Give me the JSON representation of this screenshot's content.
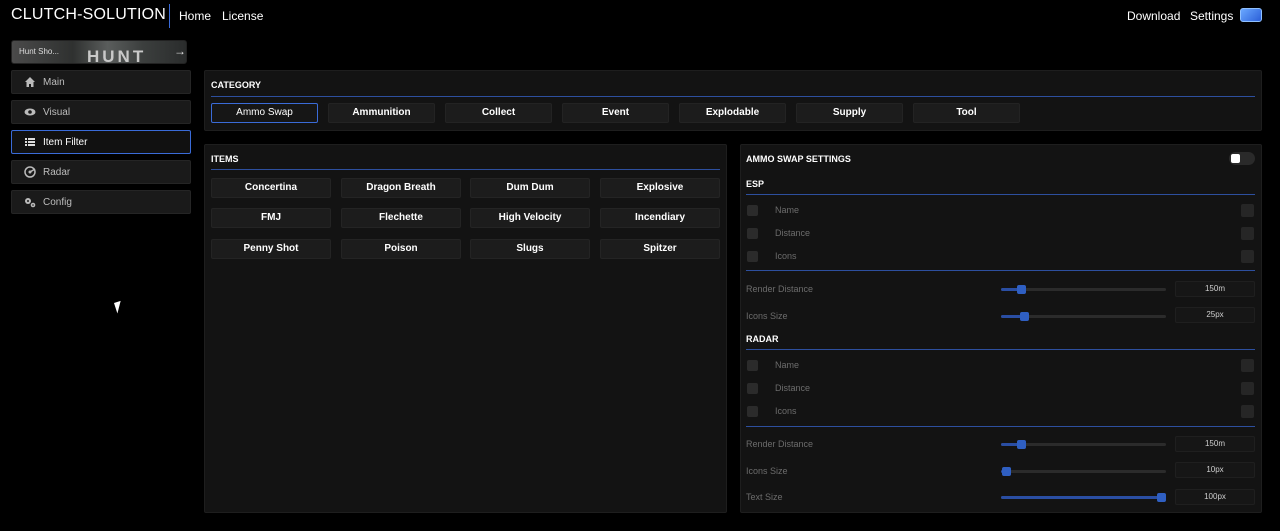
{
  "header": {
    "brand": "CLUTCH-SOLUTION",
    "nav": {
      "home": "Home",
      "license": "License"
    },
    "right": {
      "download": "Download",
      "settings": "Settings"
    }
  },
  "game": {
    "label": "Hunt Sho...",
    "logo": "HUNT"
  },
  "sidebar": {
    "items": [
      {
        "label": "Main",
        "icon": "home-icon"
      },
      {
        "label": "Visual",
        "icon": "eye-icon"
      },
      {
        "label": "Item Filter",
        "icon": "list-icon",
        "active": true
      },
      {
        "label": "Radar",
        "icon": "radar-icon"
      },
      {
        "label": "Config",
        "icon": "gears-icon"
      }
    ]
  },
  "category": {
    "title": "CATEGORY",
    "tabs": [
      "Ammo Swap",
      "Ammunition",
      "Collect",
      "Event",
      "Explodable",
      "Supply",
      "Tool"
    ],
    "selected": "Ammo Swap"
  },
  "items": {
    "title": "ITEMS",
    "buttons": [
      "Concertina",
      "Dragon Breath",
      "Dum Dum",
      "Explosive",
      "FMJ",
      "Flechette",
      "High Velocity",
      "Incendiary",
      "Penny Shot",
      "Poison",
      "Slugs",
      "Spitzer"
    ]
  },
  "settings": {
    "title": "AMMO SWAP SETTINGS",
    "enabled": false,
    "esp": {
      "title": "ESP",
      "options": [
        "Name",
        "Distance",
        "Icons"
      ],
      "render_distance": {
        "label": "Render Distance",
        "value": "150m",
        "fraction": 0.12
      },
      "icons_size": {
        "label": "Icons Size",
        "value": "25px",
        "fraction": 0.14
      }
    },
    "radar": {
      "title": "RADAR",
      "options": [
        "Name",
        "Distance",
        "Icons"
      ],
      "render_distance": {
        "label": "Render Distance",
        "value": "150m",
        "fraction": 0.12
      },
      "icons_size": {
        "label": "Icons Size",
        "value": "10px",
        "fraction": 0.03
      },
      "text_size": {
        "label": "Text Size",
        "value": "100px",
        "fraction": 0.97
      }
    }
  },
  "colors": {
    "accent": "#3a6bd8",
    "slider": "#2f5fc2",
    "panel": "#131313"
  }
}
